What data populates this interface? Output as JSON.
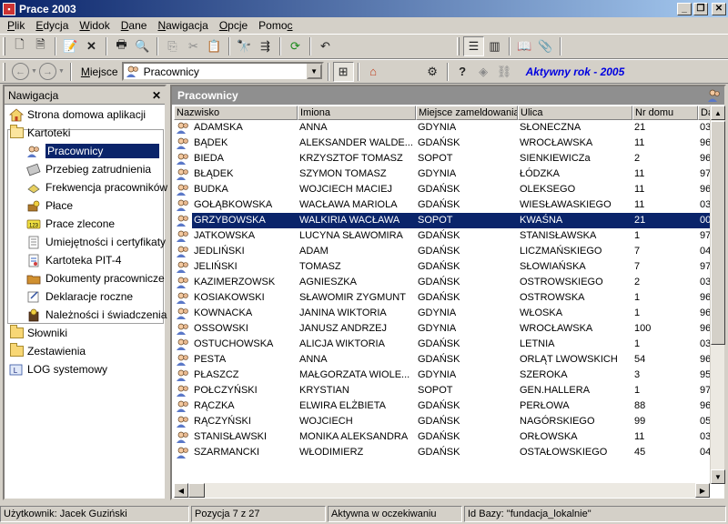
{
  "window": {
    "title": "Prace 2003"
  },
  "menu": [
    "Plik",
    "Edycja",
    "Widok",
    "Dane",
    "Nawigacja",
    "Opcje",
    "Pomoc"
  ],
  "menu_underline": [
    "P",
    "E",
    "W",
    "D",
    "N",
    "O",
    "c"
  ],
  "toolbar2": {
    "place_label": "Miejsce",
    "place_value": "Pracownicy",
    "active_year": "Aktywny rok - 2005"
  },
  "nav": {
    "title": "Nawigacja",
    "items": [
      {
        "label": "Strona domowa aplikacji",
        "icon": "home-icon"
      },
      {
        "label": "Kartoteki",
        "icon": "folder-open-icon"
      },
      {
        "label": "Pracownicy",
        "icon": "employees-icon"
      },
      {
        "label": "Przebieg zatrudnienia",
        "icon": "employment-history-icon"
      },
      {
        "label": "Frekwencja pracowników",
        "icon": "attendance-icon"
      },
      {
        "label": "Płace",
        "icon": "payroll-icon"
      },
      {
        "label": "Prace zlecone",
        "icon": "contract-work-icon"
      },
      {
        "label": "Umiejętności i certyfikaty",
        "icon": "certificate-icon"
      },
      {
        "label": "Kartoteka PIT-4",
        "icon": "pit4-icon"
      },
      {
        "label": "Dokumenty pracownicze",
        "icon": "documents-icon"
      },
      {
        "label": "Deklaracje roczne",
        "icon": "declarations-icon"
      },
      {
        "label": "Należności i świadczenia",
        "icon": "benefits-icon"
      },
      {
        "label": "Słowniki",
        "icon": "folder-icon"
      },
      {
        "label": "Zestawienia",
        "icon": "folder-icon"
      },
      {
        "label": "LOG systemowy",
        "icon": "log-icon"
      }
    ]
  },
  "grid": {
    "title": "Pracownicy",
    "columns": [
      "Nazwisko",
      "Imiona",
      "Miejsce zameldowania",
      "Ulica",
      "Nr domu",
      "Da"
    ],
    "selected_index": 6,
    "rows": [
      [
        "ADAMSKA",
        "ANNA",
        "GDYNIA",
        "SŁONECZNA",
        "21",
        "03"
      ],
      [
        "BĄDEK",
        "ALEKSANDER WALDE...",
        "GDAŃSK",
        "WROCŁAWSKA",
        "11",
        "96"
      ],
      [
        "BIEDA",
        "KRZYSZTOF TOMASZ",
        "SOPOT",
        "SIENKIEWICZa",
        "2",
        "96"
      ],
      [
        "BŁĄDEK",
        "SZYMON TOMASZ",
        "GDYNIA",
        "ŁÓDZKA",
        "11",
        "97"
      ],
      [
        "BUDKA",
        "WOJCIECH MACIEJ",
        "GDAŃSK",
        "OLEKSEGO",
        "11",
        "96"
      ],
      [
        "GOŁĄBKOWSKA",
        "WACŁAWA MARIOLA",
        "GDAŃSK",
        "WIESŁAWASKIEGO",
        "11",
        "03"
      ],
      [
        "GRZYBOWSKA",
        "WALKIRIA WACŁAWA",
        "SOPOT",
        "KWAŚNA",
        "21",
        "00"
      ],
      [
        "JATKOWSKA",
        "LUCYNA SŁAWOMIRA",
        "GDAŃSK",
        "STANISŁAWSKA",
        "1",
        "97"
      ],
      [
        "JEDLIŃSKI",
        "ADAM",
        "GDAŃSK",
        "LICZMAŃSKIEGO",
        "7",
        "04"
      ],
      [
        "JELIŃSKI",
        "TOMASZ",
        "GDAŃSK",
        "SŁOWIAŃSKA",
        "7",
        "97"
      ],
      [
        "KAZIMERZOWSK",
        "AGNIESZKA",
        "GDAŃSK",
        "OSTROWSKIEGO",
        "2",
        "03"
      ],
      [
        "KOSIAKOWSKI",
        "SŁAWOMIR ZYGMUNT",
        "GDAŃSK",
        "OSTROWSKA",
        "1",
        "96"
      ],
      [
        "KOWNACKA",
        "JANINA WIKTORIA",
        "GDYNIA",
        "WŁOSKA",
        "1",
        "96"
      ],
      [
        "OSSOWSKI",
        "JANUSZ ANDRZEJ",
        "GDYNIA",
        "WROCŁAWSKA",
        "100",
        "96"
      ],
      [
        "OSTUCHOWSKA",
        "ALICJA WIKTORIA",
        "GDAŃSK",
        "LETNIA",
        "1",
        "03"
      ],
      [
        "PESTA",
        "ANNA",
        "GDAŃSK",
        "ORLĄT LWOWSKICH",
        "54",
        "96"
      ],
      [
        "PŁASZCZ",
        "MAŁGORZATA WIOLE...",
        "GDYNIA",
        "SZEROKA",
        "3",
        "95"
      ],
      [
        "POŁCZYŃSKI",
        "KRYSTIAN",
        "SOPOT",
        "GEN.HALLERA",
        "1",
        "97"
      ],
      [
        "RĄCZKA",
        "ELWIRA ELŻBIETA",
        "GDAŃSK",
        "PERŁOWA",
        "88",
        "96"
      ],
      [
        "RĄCZYŃSKI",
        "WOJCIECH",
        "GDAŃSK",
        "NAGÓRSKIEGO",
        "99",
        "05"
      ],
      [
        "STANISŁAWSKI",
        "MONIKA ALEKSANDRA",
        "GDAŃSK",
        "ORŁOWSKA",
        "11",
        "03"
      ],
      [
        "SZARMANCKI",
        "WŁODIMIERZ",
        "GDAŃSK",
        "OSTAŁOWSKIEGO",
        "45",
        "04"
      ]
    ]
  },
  "status": {
    "user": "Użytkownik: Jacek Guziński",
    "position": "Pozycja 7 z 27",
    "state": "Aktywna w oczekiwaniu",
    "db": "Id Bazy: \"fundacja_lokalnie\""
  },
  "colors": {
    "selection": "#0a246a",
    "title_gradient_start": "#0a246a",
    "title_gradient_end": "#a6caf0",
    "active_year": "#0000e0"
  }
}
